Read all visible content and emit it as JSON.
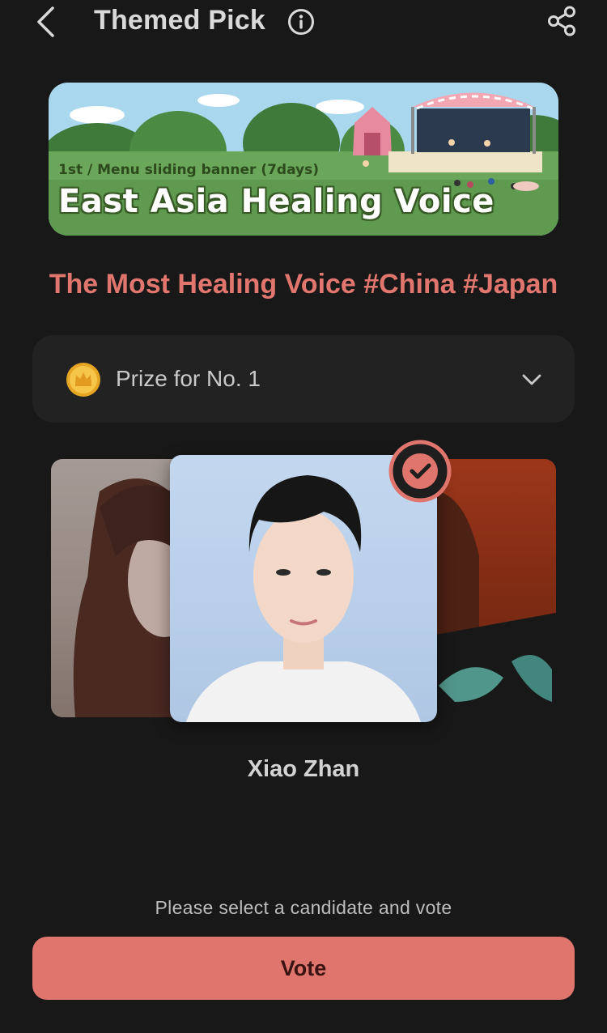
{
  "header": {
    "title": "Themed Pick",
    "icons": {
      "back": "chevron-left-icon",
      "info": "info-icon",
      "share": "share-icon"
    }
  },
  "banner": {
    "subtitle": "1st / Menu sliding banner (7days)",
    "title": "East Asia Healing Voice"
  },
  "headline": "The Most Healing Voice #China #Japan",
  "prize": {
    "label": "Prize for No. 1",
    "icon": "coin-crown-icon",
    "chevron": "chevron-down-icon"
  },
  "candidates": {
    "selected_name": "Xiao Zhan"
  },
  "footer": {
    "hint": "Please select a candidate and vote",
    "vote_label": "Vote"
  },
  "colors": {
    "accent": "#df756c",
    "background": "#181818",
    "panel": "#222222"
  }
}
